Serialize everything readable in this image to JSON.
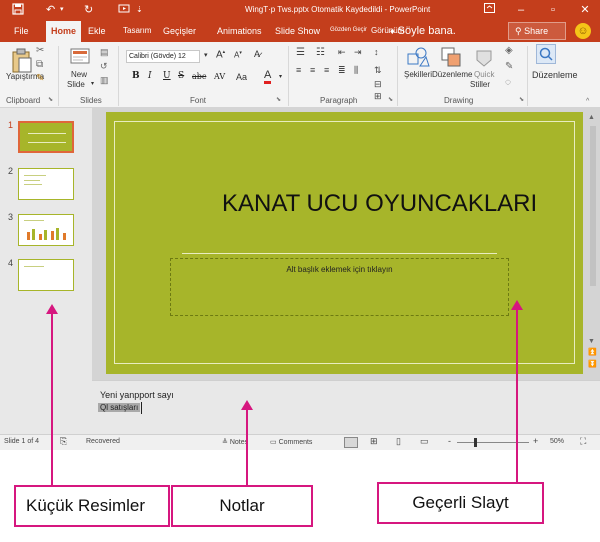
{
  "titlebar": {
    "document_title": "WingT·p Tws.pptx  Otomatik  Kaydedildi  -  PowerPoint",
    "save_icon": "save-icon",
    "undo_icon": "undo-icon",
    "redo_icon": "redo-icon",
    "start_icon": "start-from-beginning-icon"
  },
  "tabs": [
    {
      "label": "File"
    },
    {
      "label": "Home"
    },
    {
      "label": "Ekle"
    },
    {
      "label": "Tasarım"
    },
    {
      "label": "Geçişler"
    },
    {
      "label": "Animations"
    },
    {
      "label": "Slide Show"
    },
    {
      "label": "Gözden Geçir"
    },
    {
      "label": "Görünüm"
    }
  ],
  "tell_me": "Söyle bana.",
  "share": "Share",
  "ribbon": {
    "clipboard": {
      "paste": "Yapıştırma",
      "label": "Clipboard"
    },
    "slides": {
      "new_slide_line1": "New",
      "new_slide_line2": "Slide",
      "label": "Slides"
    },
    "font": {
      "font_name": "Calibri (Gövde)",
      "font_size": "12",
      "bold": "B",
      "italic": "I",
      "underline": "U",
      "strike": "S",
      "shadow": "abc",
      "spacing": "AV",
      "label": "Font"
    },
    "paragraph": {
      "label": "Paragraph"
    },
    "drawing": {
      "shapes": "Şekilleri",
      "arrange": "Düzenleme",
      "quick_styles_line1": "Quick",
      "quick_styles_line2": "Stiller",
      "label": "Drawing"
    },
    "editing": {
      "label": "Düzenleme"
    }
  },
  "thumbnails": [
    {
      "number": "1",
      "active": true
    },
    {
      "number": "2",
      "active": false
    },
    {
      "number": "3",
      "active": false
    },
    {
      "number": "4",
      "active": false
    }
  ],
  "slide": {
    "title": "KANAT UCU OYUNCAKLARI",
    "subtitle_placeholder": "Alt başlık eklemek için tıklayın",
    "background": "#a7b52a"
  },
  "notes": {
    "line1": "Yeni yanpport sayı",
    "line2": "Ql satışları"
  },
  "statusbar": {
    "slide_count": "Slide 1 of 4",
    "recovered": "Recovered",
    "notes": "Notes",
    "comments": "Comments",
    "zoom_minus": "-",
    "zoom_plus": "+",
    "zoom_percent": "50%"
  },
  "callouts": {
    "thumbnails": "Küçük Resimler",
    "notes": "Notlar",
    "current_slide": "Geçerli Slayt"
  },
  "colors": {
    "accent": "#c43e1c",
    "callout_border": "#d6177f",
    "slide_bg": "#a7b52a"
  }
}
